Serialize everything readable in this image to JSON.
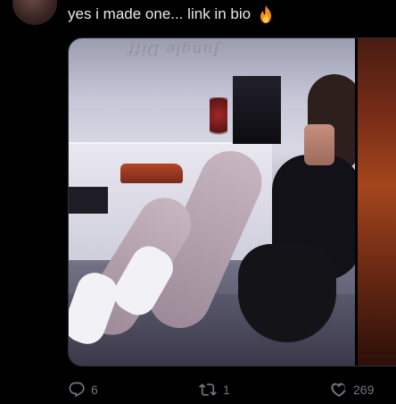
{
  "post": {
    "text": "yes i made one... link in bio",
    "emoji_icon": "fire-icon"
  },
  "media": {
    "wall_text": "Jungle Diff"
  },
  "actions": {
    "reply_count": "6",
    "repost_count": "1",
    "like_count": "269"
  },
  "colors": {
    "background": "#000000",
    "text": "#e7e9ea",
    "muted": "#71767b",
    "border": "#2f3336"
  }
}
